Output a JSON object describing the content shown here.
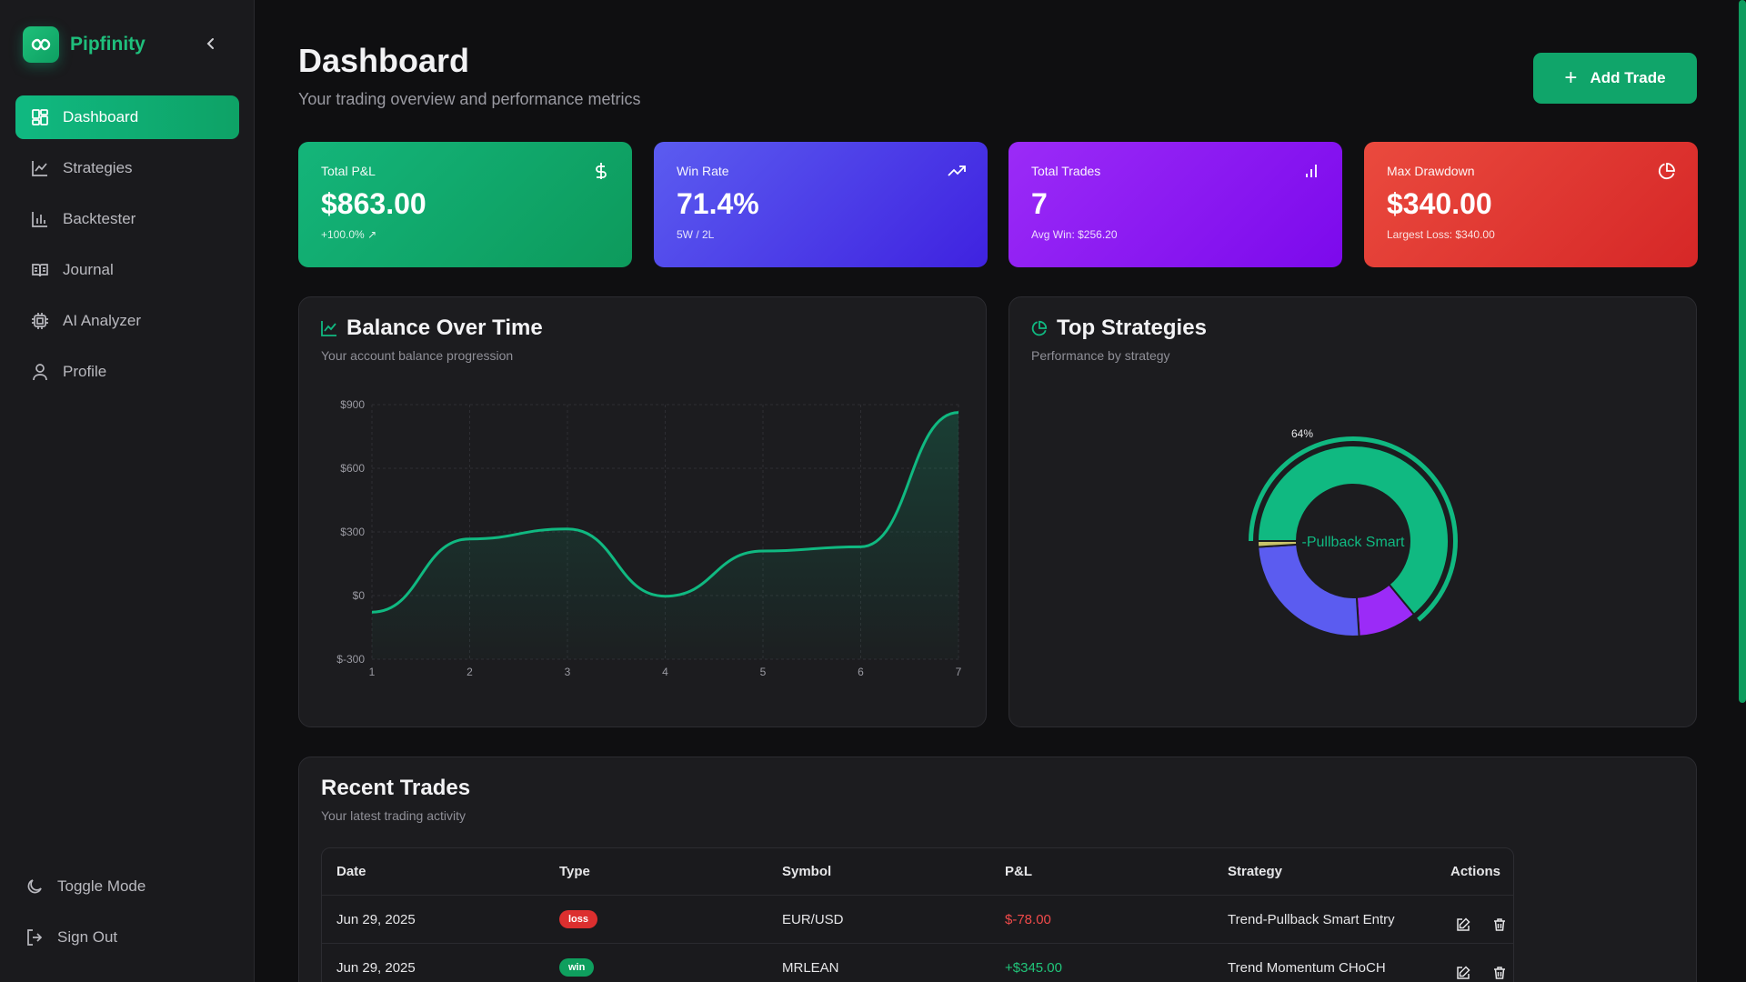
{
  "app": {
    "name": "Pipfinity"
  },
  "sidebar": {
    "items": [
      {
        "label": "Dashboard",
        "icon": "dashboard-icon",
        "active": true
      },
      {
        "label": "Strategies",
        "icon": "line-chart-icon"
      },
      {
        "label": "Backtester",
        "icon": "bar-chart-icon"
      },
      {
        "label": "Journal",
        "icon": "book-icon"
      },
      {
        "label": "AI Analyzer",
        "icon": "cpu-icon"
      },
      {
        "label": "Profile",
        "icon": "user-icon"
      }
    ],
    "bottom": [
      {
        "label": "Toggle Mode",
        "icon": "moon-icon"
      },
      {
        "label": "Sign Out",
        "icon": "sign-out-icon"
      }
    ]
  },
  "header": {
    "title": "Dashboard",
    "subtitle": "Your trading overview and performance metrics",
    "add_button": "Add Trade"
  },
  "stats": [
    {
      "label": "Total P&L",
      "value": "$863.00",
      "sub": "+100.0%",
      "icon": "dollar-icon",
      "color": "#10b981"
    },
    {
      "label": "Win Rate",
      "value": "71.4%",
      "sub": "5W / 2L",
      "icon": "trending-up-icon",
      "color": "#4f46e5"
    },
    {
      "label": "Total Trades",
      "value": "7",
      "sub": "Avg Win: $256.20",
      "icon": "bar-chart-icon",
      "color": "#8b10f5"
    },
    {
      "label": "Max Drawdown",
      "value": "$340.00",
      "sub": "Largest Loss: $340.00",
      "icon": "pie-icon",
      "color": "#e23232"
    }
  ],
  "balance_panel": {
    "title": "Balance Over Time",
    "subtitle": "Your account balance progression"
  },
  "strategies_panel": {
    "title": "Top Strategies",
    "subtitle": "Performance by strategy"
  },
  "chart_data": [
    {
      "type": "area",
      "x": [
        1,
        2,
        3,
        4,
        5,
        6,
        7
      ],
      "y": [
        -78,
        267,
        314,
        -3,
        210,
        230,
        863
      ],
      "ylim": [
        -300,
        900
      ],
      "yticks": [
        "$-300",
        "$0",
        "$300",
        "$600",
        "$900"
      ],
      "ytick_values": [
        -300,
        0,
        300,
        600,
        900
      ],
      "xticks": [
        "1",
        "2",
        "3",
        "4",
        "5",
        "6",
        "7"
      ],
      "grid": true,
      "color": "#10b981"
    },
    {
      "type": "pie",
      "donut": true,
      "slices": [
        {
          "name": "Trend-Pullback Smart Entry",
          "value": 64,
          "color": "#10b981"
        },
        {
          "name": "",
          "value": 10,
          "color": "#9b2bf7"
        },
        {
          "name": "",
          "value": 25,
          "color": "#5b5cf0"
        },
        {
          "name": "",
          "value": 1,
          "color": "#c9c46a"
        }
      ],
      "active_label": "-Pullback Smart",
      "percent_label": "64%"
    }
  ],
  "trades": {
    "title": "Recent Trades",
    "subtitle": "Your latest trading activity",
    "columns": [
      "Date",
      "Type",
      "Symbol",
      "P&L",
      "Strategy",
      "Actions"
    ],
    "rows": [
      {
        "date": "Jun 29, 2025",
        "type": "loss",
        "symbol": "EUR/USD",
        "pnl": "$-78.00",
        "strategy": "Trend-Pullback Smart Entry"
      },
      {
        "date": "Jun 29, 2025",
        "type": "win",
        "symbol": "MRLEAN",
        "pnl": "+$345.00",
        "strategy": "Trend Momentum CHoCH"
      }
    ]
  }
}
